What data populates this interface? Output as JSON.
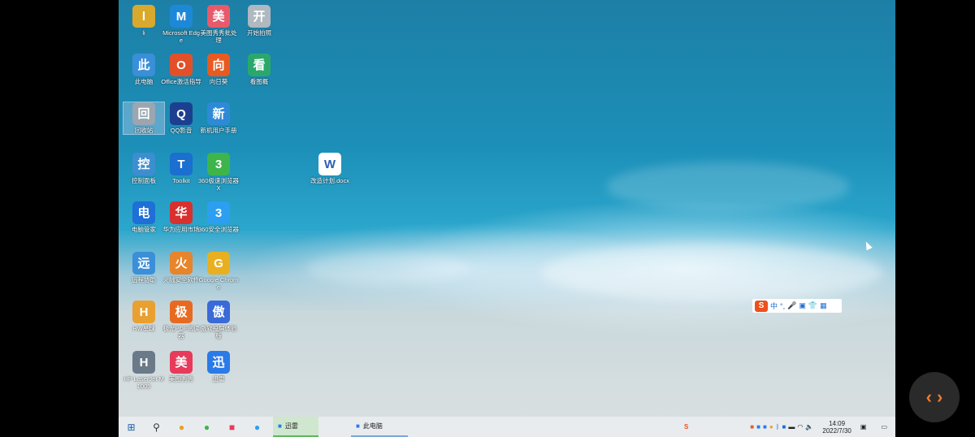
{
  "desktop_icons": [
    {
      "label": "li",
      "icon": "user-folder-icon",
      "color": "#d9a92e"
    },
    {
      "label": "Microsoft Edge",
      "icon": "edge-icon",
      "color": "#1e88d8"
    },
    {
      "label": "美图秀秀批处理",
      "icon": "meitu-batch-icon",
      "color": "#e85a6a"
    },
    {
      "label": "开始拍照",
      "icon": "camera-icon",
      "color": "#b0b8c0"
    },
    {
      "label": "此电脑",
      "icon": "this-pc-icon",
      "color": "#3a8fd8"
    },
    {
      "label": "Office激活指导",
      "icon": "office-icon",
      "color": "#e2502a"
    },
    {
      "label": "向日葵",
      "icon": "sunflower-icon",
      "color": "#e85a20"
    },
    {
      "label": "看图概",
      "icon": "image-viewer-icon",
      "color": "#2aa86c"
    },
    {
      "label": "回收站",
      "icon": "recycle-bin-icon",
      "color": "#9aa6b0"
    },
    {
      "label": "QQ影音",
      "icon": "qq-player-icon",
      "color": "#1d3f8f"
    },
    {
      "label": "新机用户手册",
      "icon": "manual-icon",
      "color": "#2e8ad6"
    },
    {
      "label": "控制面板",
      "icon": "control-panel-icon",
      "color": "#3c8ed0"
    },
    {
      "label": "Toolkit",
      "icon": "toolkit-icon",
      "color": "#1a6fcf"
    },
    {
      "label": "360极速浏览器X",
      "icon": "360-browser-icon",
      "color": "#3db54a"
    },
    {
      "label": "电脑管家",
      "icon": "pc-manager-icon",
      "color": "#1e6fd6"
    },
    {
      "label": "华为应用市场",
      "icon": "huawei-appgallery-icon",
      "color": "#d8302f"
    },
    {
      "label": "360安全浏览器",
      "icon": "360-safe-browser-icon",
      "color": "#2c9ff0"
    },
    {
      "label": "远程协助",
      "icon": "remote-assist-icon",
      "color": "#3b8fd8"
    },
    {
      "label": "火绒安全软件",
      "icon": "huorong-icon",
      "color": "#e8842a"
    },
    {
      "label": "Google Chrome",
      "icon": "chrome-icon",
      "color": "#e8b020"
    },
    {
      "label": "HW星球",
      "icon": "hw-planet-icon",
      "color": "#e8a030"
    },
    {
      "label": "极光PDF阅读器",
      "icon": "pdf-icon",
      "color": "#e86a20"
    },
    {
      "label": "傲软投屏体验版",
      "icon": "screen-cast-icon",
      "color": "#3a6ad8"
    },
    {
      "label": "HP LaserJet M1005",
      "icon": "printer-icon",
      "color": "#6a7a88"
    },
    {
      "label": "美图秀秀",
      "icon": "meitu-icon",
      "color": "#e83a5a"
    },
    {
      "label": "迅雷",
      "icon": "thunder-icon",
      "color": "#2a7ae8"
    }
  ],
  "desktop_file": {
    "label": "改造计划.docx",
    "icon": "word-doc-icon",
    "color": "#2b5fb3"
  },
  "ime_toolbar": {
    "logo": "S",
    "mode": "中",
    "punct": "°,",
    "icons": [
      "mic-icon",
      "keyboard-icon",
      "skin-icon",
      "toolbox-icon"
    ]
  },
  "taskbar": {
    "pinned": [
      {
        "name": "start-button",
        "glyph": "⊞",
        "color": "#1e5fa8"
      },
      {
        "name": "search-button",
        "glyph": "⚲",
        "color": "#333"
      },
      {
        "name": "taskbar-chrome",
        "glyph": "●",
        "color": "#e8a020"
      },
      {
        "name": "taskbar-360-browser",
        "glyph": "●",
        "color": "#3db54a"
      },
      {
        "name": "taskbar-meitu",
        "glyph": "■",
        "color": "#e83a5a"
      },
      {
        "name": "taskbar-360-safe",
        "glyph": "●",
        "color": "#2c9ff0"
      }
    ],
    "running": [
      {
        "label": "迅雷",
        "icon": "thunder-icon",
        "active": true
      },
      {
        "label": "此电脑",
        "icon": "this-pc-icon",
        "active": false
      }
    ],
    "clock_time": "14:09",
    "clock_date": "2022/7/30"
  },
  "accent": "#f07a2c"
}
